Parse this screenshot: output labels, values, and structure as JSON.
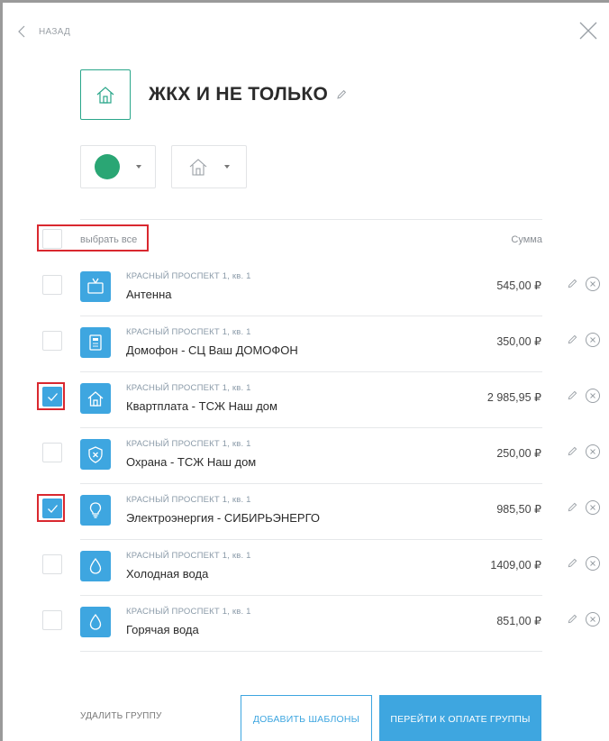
{
  "nav": {
    "back_label": "НАЗАД"
  },
  "group": {
    "title": "ЖКХ И НЕ ТОЛЬКО",
    "color": "#2aa674",
    "accent": "#2aa68a"
  },
  "list": {
    "select_all_label": "выбрать все",
    "sum_header": "Сумма",
    "rows": [
      {
        "address": "КРАСНЫЙ ПРОСПЕКТ 1, кв. 1",
        "name": "Антенна",
        "amount": "545,00 ₽",
        "checked": false,
        "icon": "tv-icon"
      },
      {
        "address": "КРАСНЫЙ ПРОСПЕКТ 1, кв. 1",
        "name": "Домофон - СЦ Ваш ДОМОФОН",
        "amount": "350,00 ₽",
        "checked": false,
        "icon": "intercom-icon"
      },
      {
        "address": "КРАСНЫЙ ПРОСПЕКТ 1, кв. 1",
        "name": "Квартплата - ТСЖ Наш дом",
        "amount": "2 985,95 ₽",
        "checked": true,
        "icon": "house-icon"
      },
      {
        "address": "КРАСНЫЙ ПРОСПЕКТ 1, кв. 1",
        "name": "Охрана - ТСЖ Наш дом",
        "amount": "250,00 ₽",
        "checked": false,
        "icon": "shield-icon"
      },
      {
        "address": "КРАСНЫЙ ПРОСПЕКТ 1, кв. 1",
        "name": "Электроэнергия - СИБИРЬЭНЕРГО",
        "amount": "985,50 ₽",
        "checked": true,
        "icon": "lightbulb-icon"
      },
      {
        "address": "КРАСНЫЙ ПРОСПЕКТ 1, кв. 1",
        "name": "Холодная вода",
        "amount": "1409,00 ₽",
        "checked": false,
        "icon": "water-drop-icon"
      },
      {
        "address": "КРАСНЫЙ ПРОСПЕКТ 1, кв. 1",
        "name": "Горячая вода",
        "amount": "851,00 ₽",
        "checked": false,
        "icon": "water-drop-icon"
      }
    ]
  },
  "footer": {
    "delete_label": "УДАЛИТЬ ГРУППУ",
    "add_label": "ДОБАВИТЬ ШАБЛОНЫ",
    "pay_label": "ПЕРЕЙТИ К ОПЛАТЕ ГРУППЫ"
  },
  "colors": {
    "primary": "#3ea6e0",
    "highlight": "#d9282f"
  }
}
